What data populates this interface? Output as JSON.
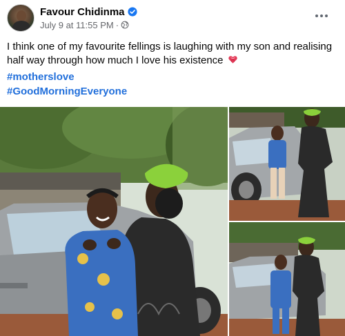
{
  "post": {
    "author_name": "Favour Chidinma",
    "timestamp": "July 9 at 11:55 PM",
    "separator": "·",
    "audience_icon": "globe-icon",
    "verified_icon": "verified-badge-icon",
    "more_icon": "more-options-icon",
    "text": "I think one of my favourite fellings is laughing with my son and realising half way through how much I love his existence",
    "text_emoji": "heart-with-ribbon-icon",
    "hashtags": [
      "#motherslove",
      "#GoodMorningEveryone"
    ],
    "photos_count": 3
  },
  "colors": {
    "link": "#216fdb",
    "secondary_text": "#65676b",
    "verified": "#1877f2",
    "beret": "#8bd13b"
  }
}
